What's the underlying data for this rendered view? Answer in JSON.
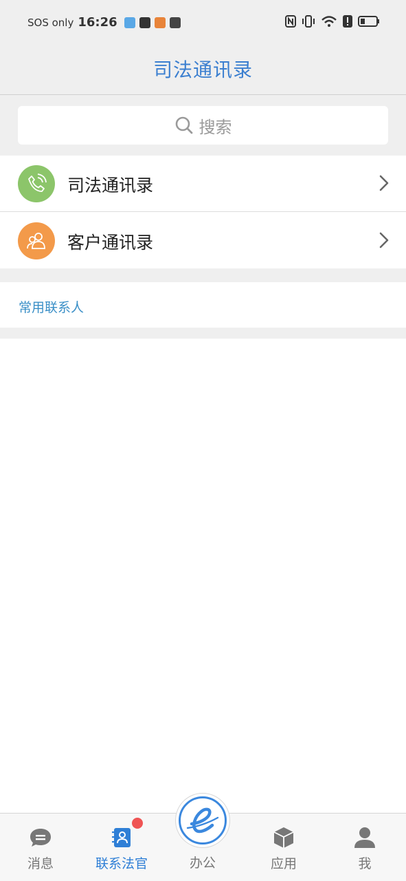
{
  "status_bar": {
    "carrier": "SOS only",
    "time": "16:26"
  },
  "header": {
    "title": "司法通讯录"
  },
  "search": {
    "placeholder": "搜索"
  },
  "directory": [
    {
      "label": "司法通讯录",
      "icon": "phone-call-icon",
      "color": "#8cc56a"
    },
    {
      "label": "客户通讯录",
      "icon": "people-icon",
      "color": "#f39a4a"
    }
  ],
  "frequent": {
    "label": "常用联系人"
  },
  "tabs": [
    {
      "label": "消息",
      "icon": "message-icon",
      "active": false
    },
    {
      "label": "联系法官",
      "icon": "contact-book-icon",
      "active": true,
      "badge": true
    },
    {
      "label": "办公",
      "icon": "office-e-icon",
      "active": false
    },
    {
      "label": "应用",
      "icon": "app-cube-icon",
      "active": false
    },
    {
      "label": "我",
      "icon": "person-icon",
      "active": false
    }
  ],
  "colors": {
    "accent": "#3b7fd0",
    "active_tab": "#2f7fd6",
    "badge": "#ef5454",
    "link": "#3a8fc7"
  }
}
